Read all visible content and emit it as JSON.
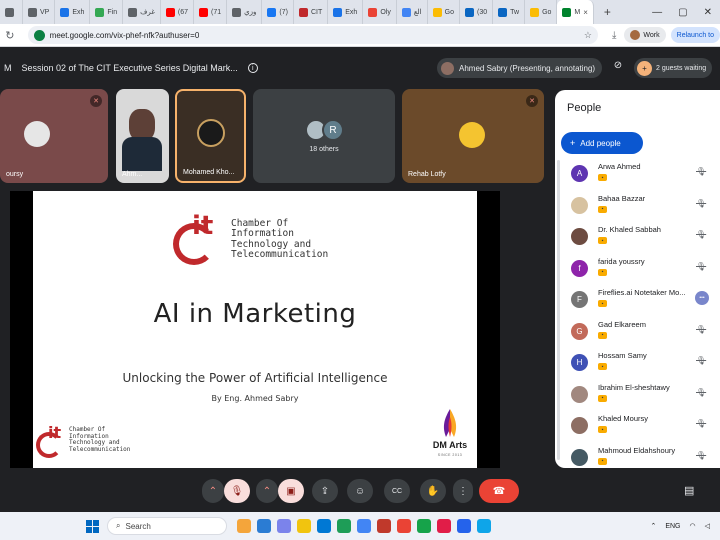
{
  "browser": {
    "tabs": [
      {
        "label": "",
        "color": "#5f6368"
      },
      {
        "label": "VP",
        "color": "#5f6368"
      },
      {
        "label": "Exh",
        "color": "#1a73e8"
      },
      {
        "label": "Fin",
        "color": "#34a853"
      },
      {
        "label": "غرف",
        "color": "#5f6368"
      },
      {
        "label": "(67",
        "color": "#ff0000"
      },
      {
        "label": "(71",
        "color": "#ff0000"
      },
      {
        "label": "وزي",
        "color": "#5f6368"
      },
      {
        "label": "(7)",
        "color": "#1877f2"
      },
      {
        "label": "CIT",
        "color": "#c0292c"
      },
      {
        "label": "Exh",
        "color": "#1a73e8"
      },
      {
        "label": "Oly",
        "color": "#ea4335"
      },
      {
        "label": "الع",
        "color": "#4285f4"
      },
      {
        "label": "Go",
        "color": "#fbbc04"
      },
      {
        "label": "(30",
        "color": "#0a66c2"
      },
      {
        "label": "Tw",
        "color": "#0a66c2"
      },
      {
        "label": "Go",
        "color": "#fbbc04"
      }
    ],
    "active_tab": {
      "label": "M",
      "close": "×"
    },
    "new_tab": "+",
    "window_controls": [
      "—",
      "▢",
      "✕"
    ],
    "url": "meet.google.com/vix-phef-nfk?authuser=0",
    "profile_label": "Work",
    "relaunch_label": "Relaunch to"
  },
  "meet": {
    "title_prefix": "M",
    "meeting_title": "Session 02 of The CIT Executive Series Digital Mark...",
    "presenter_chip": "Ahmed Sabry (Presenting, annotating)",
    "guests_waiting": "2 guests waiting",
    "tiles": [
      {
        "name": "oursy",
        "bg": "#7a4a4a",
        "muted": true
      },
      {
        "name": "Ahm...",
        "bg": "#d9d9d9",
        "muted": false
      },
      {
        "name": "Mohamed Kho...",
        "bg": "#3a2e24",
        "muted": false
      },
      {
        "name": "18 others",
        "bg": "#3c4043",
        "muted": false
      },
      {
        "name": "Rehab Lotfy",
        "bg": "#6b4a2a",
        "muted": true
      }
    ],
    "others_initial": "R"
  },
  "slide": {
    "logo_top": {
      "it": "it",
      "lines": [
        "Chamber Of",
        "Information",
        "Technology and",
        "Telecommunication"
      ]
    },
    "title": "AI in Marketing",
    "subtitle": "Unlocking the Power of Artificial Intelligence",
    "byline": "By Eng. Ahmed Sabry",
    "logo_bottom": {
      "it": "it",
      "lines": [
        "Chamber Of",
        "Information",
        "Technology and",
        "Telecommunication"
      ]
    },
    "dm_logo": {
      "name": "DM Arts",
      "tag": "SINCE 2013"
    }
  },
  "people_panel": {
    "title": "People",
    "add_people": "Add people",
    "participants": [
      {
        "name": "Arwa Ahmed",
        "initial": "A",
        "color": "#5e35b1",
        "action": "mute"
      },
      {
        "name": "Bahaa Bazzar",
        "initial": "",
        "color": "#d7c2a0",
        "action": "mute"
      },
      {
        "name": "Dr. Khaled Sabbah",
        "initial": "",
        "color": "#6d4c41",
        "action": "mute"
      },
      {
        "name": "farida youssry",
        "initial": "f",
        "color": "#8e24aa",
        "action": "mute"
      },
      {
        "name": "Fireflies.ai Notetaker Mo...",
        "initial": "F",
        "color": "#757575",
        "action": "more"
      },
      {
        "name": "Gad Elkareem",
        "initial": "G",
        "color": "#c26a5a",
        "action": "mute"
      },
      {
        "name": "Hossam Samy",
        "initial": "H",
        "color": "#3f51b5",
        "action": "mute"
      },
      {
        "name": "Ibrahim El-sheshtawy",
        "initial": "",
        "color": "#a1887f",
        "action": "mute"
      },
      {
        "name": "Khaled Moursy",
        "initial": "",
        "color": "#8d6e63",
        "action": "mute"
      },
      {
        "name": "Mahmoud Eldahshoury",
        "initial": "",
        "color": "#455a64",
        "action": "mute"
      }
    ]
  },
  "controls": {
    "caret": "⌃",
    "mic_off": "🎙",
    "cam_off": "▣",
    "present": "⇪",
    "emoji": "☺",
    "captions": "CC",
    "raise_hand": "✋",
    "more": "⋮",
    "end_call": "☎",
    "chat": "▤"
  },
  "taskbar": {
    "search_placeholder": "Search",
    "language": "ENG",
    "app_colors": [
      "#f4a53b",
      "#2b7cd3",
      "#7b83eb",
      "#f1c40f",
      "#0078d4",
      "#1e9d57",
      "#4285f4",
      "#c0392b",
      "#ea4335",
      "#16a34a",
      "#e11d48",
      "#2563eb",
      "#0ea5e9"
    ]
  }
}
